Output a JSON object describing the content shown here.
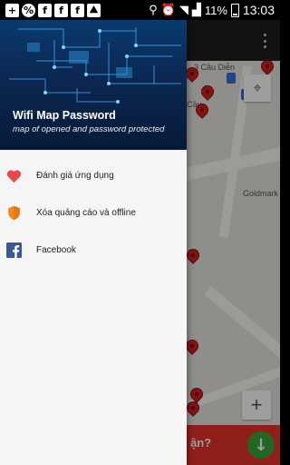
{
  "status_bar": {
    "notification_icons": [
      "plus-icon",
      "percent-icon",
      "facebook-icon",
      "facebook-icon",
      "facebook-icon",
      "image-icon"
    ],
    "battery": "11%",
    "time": "13:03"
  },
  "map": {
    "labels": [
      "3 Cầu Diễn",
      "Cầu",
      "Goldmark"
    ],
    "ad_text": "ận?",
    "pin_color": "#d81f1f"
  },
  "drawer": {
    "header": {
      "title": "Wifi Map Password",
      "subtitle": "map of opened and password protected"
    },
    "items": [
      {
        "label": "Đánh giá ứng dụng",
        "icon": "heart-icon",
        "color": "#e8474f"
      },
      {
        "label": "Xóa quảng cáo và offline",
        "icon": "shield-icon",
        "color": "#f08a1c"
      },
      {
        "label": "Facebook",
        "icon": "facebook-icon",
        "color": "#3b5998"
      }
    ]
  }
}
